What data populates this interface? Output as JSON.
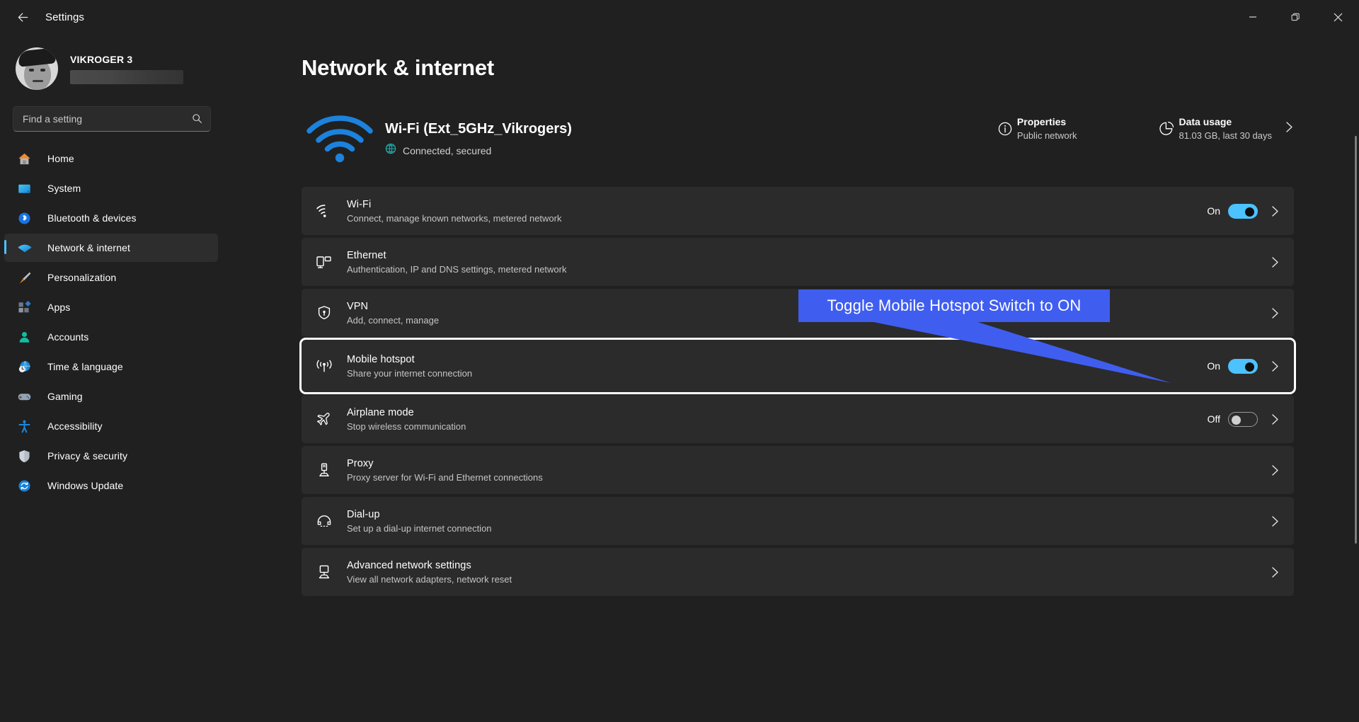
{
  "window": {
    "title": "Settings",
    "back_icon": "back-arrow-icon",
    "minimize_label": "—",
    "maximize_label": "❑",
    "close_label": "✕"
  },
  "account": {
    "name": "VIKROGER 3",
    "email_redacted": ""
  },
  "search": {
    "placeholder": "Find a setting",
    "value": "",
    "icon": "search-icon"
  },
  "sidebar": {
    "items": [
      {
        "label": "Home",
        "icon": "home-icon",
        "active": false
      },
      {
        "label": "System",
        "icon": "system-icon",
        "active": false
      },
      {
        "label": "Bluetooth & devices",
        "icon": "bluetooth-icon",
        "active": false
      },
      {
        "label": "Network & internet",
        "icon": "network-icon",
        "active": true
      },
      {
        "label": "Personalization",
        "icon": "paintbrush-icon",
        "active": false
      },
      {
        "label": "Apps",
        "icon": "apps-icon",
        "active": false
      },
      {
        "label": "Accounts",
        "icon": "accounts-icon",
        "active": false
      },
      {
        "label": "Time & language",
        "icon": "clock-globe-icon",
        "active": false
      },
      {
        "label": "Gaming",
        "icon": "gamepad-icon",
        "active": false
      },
      {
        "label": "Accessibility",
        "icon": "accessibility-icon",
        "active": false
      },
      {
        "label": "Privacy & security",
        "icon": "shield-icon",
        "active": false
      },
      {
        "label": "Windows Update",
        "icon": "update-icon",
        "active": false
      }
    ]
  },
  "page": {
    "title": "Network & internet"
  },
  "connection": {
    "icon": "wifi-signal-icon",
    "name": "Wi-Fi (Ext_5GHz_Vikrogers)",
    "status_icon": "globe-icon",
    "status": "Connected, secured",
    "properties": {
      "icon": "info-icon",
      "title": "Properties",
      "subtitle": "Public network"
    },
    "data_usage": {
      "icon": "pie-chart-icon",
      "title": "Data usage",
      "subtitle": "81.03 GB, last 30 days",
      "chevron": "chevron-right-icon"
    }
  },
  "settings_rows": [
    {
      "icon": "wifi-icon",
      "title": "Wi-Fi",
      "subtitle": "Connect, manage known networks, metered network",
      "toggle_label": "On",
      "toggle_state": "on",
      "highlighted": false
    },
    {
      "icon": "ethernet-icon",
      "title": "Ethernet",
      "subtitle": "Authentication, IP and DNS settings, metered network",
      "toggle_label": "",
      "toggle_state": "none",
      "highlighted": false
    },
    {
      "icon": "vpn-shield-icon",
      "title": "VPN",
      "subtitle": "Add, connect, manage",
      "toggle_label": "",
      "toggle_state": "none",
      "highlighted": false
    },
    {
      "icon": "hotspot-icon",
      "title": "Mobile hotspot",
      "subtitle": "Share your internet connection",
      "toggle_label": "On",
      "toggle_state": "on",
      "highlighted": true
    },
    {
      "icon": "airplane-icon",
      "title": "Airplane mode",
      "subtitle": "Stop wireless communication",
      "toggle_label": "Off",
      "toggle_state": "off",
      "highlighted": false
    },
    {
      "icon": "proxy-icon",
      "title": "Proxy",
      "subtitle": "Proxy server for Wi-Fi and Ethernet connections",
      "toggle_label": "",
      "toggle_state": "none",
      "highlighted": false
    },
    {
      "icon": "dialup-icon",
      "title": "Dial-up",
      "subtitle": "Set up a dial-up internet connection",
      "toggle_label": "",
      "toggle_state": "none",
      "highlighted": false
    },
    {
      "icon": "advanced-network-icon",
      "title": "Advanced network settings",
      "subtitle": "View all network adapters, network reset",
      "toggle_label": "",
      "toggle_state": "none",
      "highlighted": false
    }
  ],
  "annotation": {
    "text": "Toggle Mobile Hotspot Switch to ON",
    "box_color": "#3f5ef0",
    "text_color": "#ffffff",
    "pointer_color": "#3f5ef0"
  },
  "colors": {
    "accent": "#4cc2ff",
    "window_bg": "#202020",
    "card_bg": "#2b2b2b",
    "highlight_outline": "#ffffff"
  }
}
